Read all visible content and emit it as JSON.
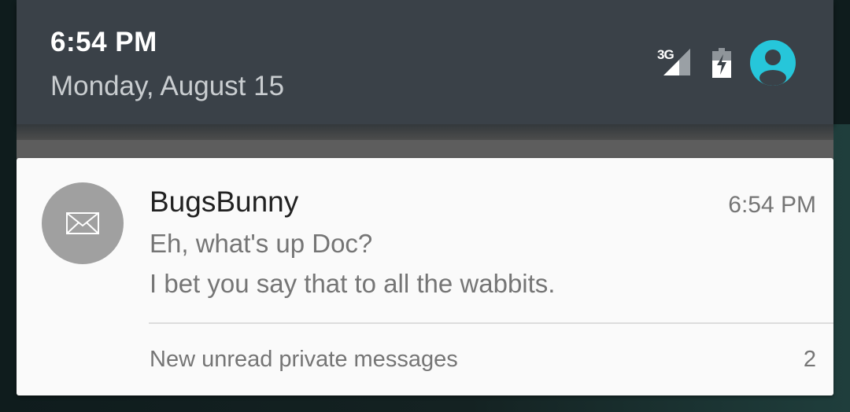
{
  "status_bar": {
    "time": "6:54 PM",
    "date": "Monday, August 15",
    "network_type": "3G",
    "icons": [
      "signal-3g-icon",
      "battery-charging-icon",
      "user-avatar-icon"
    ],
    "avatar_color": "#26c6da"
  },
  "notification": {
    "app_icon": "envelope-icon",
    "sender": "BugsBunny",
    "time": "6:54 PM",
    "lines": [
      "Eh, what's up Doc?",
      "I bet you say that to all the wabbits."
    ],
    "summary": "New unread private messages",
    "count": "2"
  }
}
